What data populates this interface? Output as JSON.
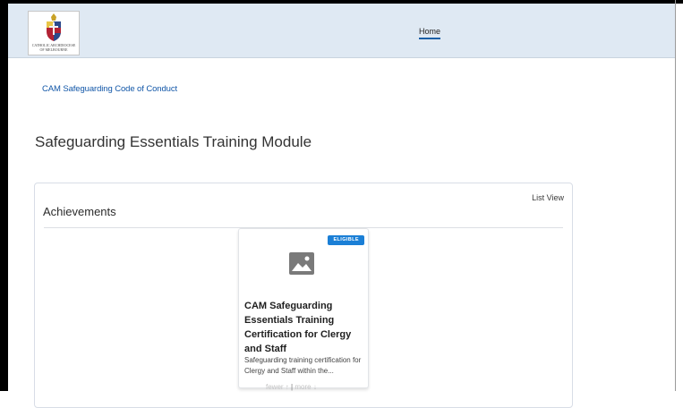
{
  "header": {
    "logo_text": "CATHOLIC ARCHDIOCESE OF MELBOURNE",
    "nav": {
      "home_label": "Home"
    }
  },
  "page": {
    "link_text": "CAM Safeguarding Code of Conduct",
    "title": "Safeguarding Essentials Training Module"
  },
  "achievements": {
    "title": "Achievements",
    "list_view_label": "List View",
    "items": [
      {
        "badge": "ELIGIBLE",
        "image_icon": "image-placeholder-icon",
        "title": "CAM Safeguarding Essentials Training Certification for Clergy and Staff",
        "description": "Safeguarding training certification for Clergy and Staff within the..."
      }
    ]
  },
  "pager": {
    "fewer_label": "fewer",
    "fewer_icon": "↑",
    "separator": "|",
    "more_label": "more",
    "more_icon": "↓"
  },
  "colors": {
    "header_bg": "#dfe9f3",
    "link": "#1257a8",
    "badge": "#1b7fd6",
    "nav_underline": "#1b5fa6"
  }
}
